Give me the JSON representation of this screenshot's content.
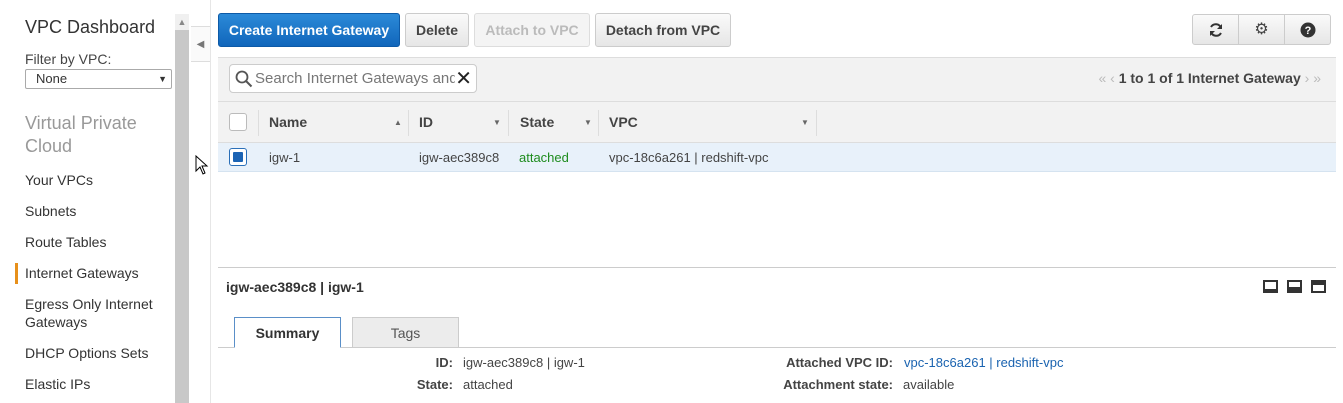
{
  "sidebar": {
    "title": "VPC Dashboard",
    "filter_label": "Filter by VPC:",
    "filter_value": "None",
    "section": "Virtual Private Cloud",
    "items": [
      {
        "label": "Your VPCs"
      },
      {
        "label": "Subnets"
      },
      {
        "label": "Route Tables"
      },
      {
        "label": "Internet Gateways"
      },
      {
        "label": "Egress Only Internet Gateways"
      },
      {
        "label": "DHCP Options Sets"
      },
      {
        "label": "Elastic IPs"
      }
    ],
    "active_item": "Internet Gateways"
  },
  "toolbar": {
    "create_label": "Create Internet Gateway",
    "delete_label": "Delete",
    "attach_label": "Attach to VPC",
    "detach_label": "Detach from VPC",
    "refresh_icon": "refresh-icon",
    "settings_icon": "gear-icon",
    "help_icon": "help-icon"
  },
  "search": {
    "placeholder": "Search Internet Gateways and their properties",
    "clear_icon": "close-icon"
  },
  "pager": {
    "text": "1 to 1 of 1 Internet Gateway"
  },
  "table": {
    "columns": [
      "Name",
      "ID",
      "State",
      "VPC"
    ],
    "rows": [
      {
        "name": "igw-1",
        "id": "igw-aec389c8",
        "state": "attached",
        "vpc": "vpc-18c6a261 | redshift-vpc",
        "selected": true
      }
    ]
  },
  "detail": {
    "title": "igw-aec389c8 | igw-1",
    "tabs": [
      "Summary",
      "Tags"
    ],
    "active_tab": "Summary",
    "fields": {
      "id_label": "ID:",
      "id_value": "igw-aec389c8 | igw-1",
      "state_label": "State:",
      "state_value": "attached",
      "attached_vpc_label": "Attached VPC ID:",
      "attached_vpc_value": "vpc-18c6a261 | redshift-vpc",
      "attachment_state_label": "Attachment state:",
      "attachment_state_value": "available"
    }
  },
  "colors": {
    "primary": "#1a6fc4",
    "active_marker": "#e7901b",
    "state_green": "#1e8c1e",
    "link": "#1a63b0",
    "selected_row": "#e8f1fa"
  }
}
